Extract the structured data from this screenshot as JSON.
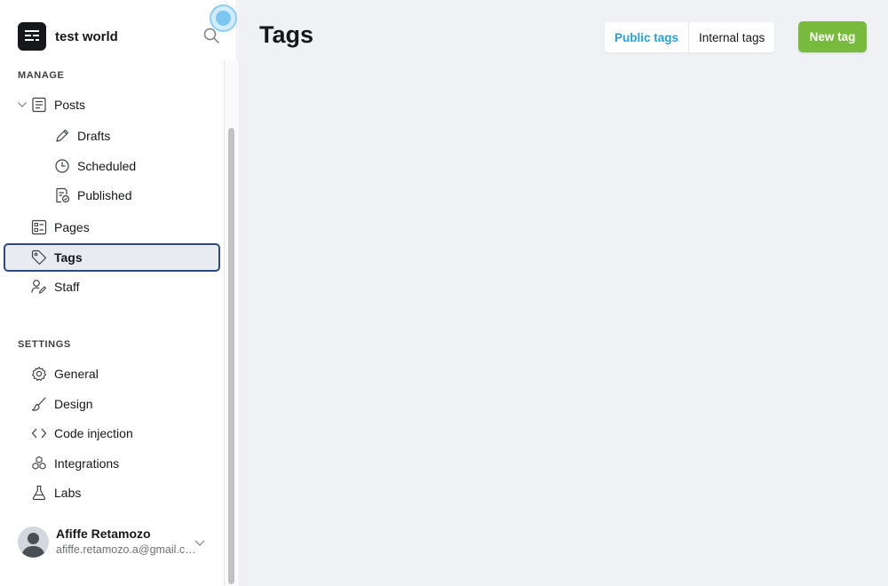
{
  "site": {
    "title": "test world"
  },
  "sidebar": {
    "manage_label": "MANAGE",
    "settings_label": "SETTINGS",
    "posts": {
      "label": "Posts",
      "icon": "posts-icon"
    },
    "post_subitems": [
      {
        "label": "Drafts",
        "icon": "pencil-icon"
      },
      {
        "label": "Scheduled",
        "icon": "clock-icon"
      },
      {
        "label": "Published",
        "icon": "published-icon"
      }
    ],
    "manage_items": [
      {
        "label": "Pages",
        "icon": "pages-icon"
      },
      {
        "label": "Tags",
        "icon": "tag-icon",
        "active": true
      },
      {
        "label": "Staff",
        "icon": "staff-icon"
      }
    ],
    "settings_items": [
      {
        "label": "General",
        "icon": "gear-icon"
      },
      {
        "label": "Design",
        "icon": "brush-icon"
      },
      {
        "label": "Code injection",
        "icon": "code-icon"
      },
      {
        "label": "Integrations",
        "icon": "integrations-icon"
      },
      {
        "label": "Labs",
        "icon": "flask-icon"
      }
    ]
  },
  "user": {
    "name": "Afiffe Retamozo",
    "email": "afiffe.retamozo.a@gmail.com"
  },
  "main": {
    "title": "Tags",
    "tabs": [
      {
        "label": "Public tags",
        "selected": true
      },
      {
        "label": "Internal tags",
        "selected": false
      }
    ],
    "new_button": "New tag"
  },
  "colors": {
    "accent_green": "#77ba3c",
    "accent_blue": "#2a9fd6",
    "active_border": "#2f4a7a",
    "main_bg": "#eff1f4"
  }
}
